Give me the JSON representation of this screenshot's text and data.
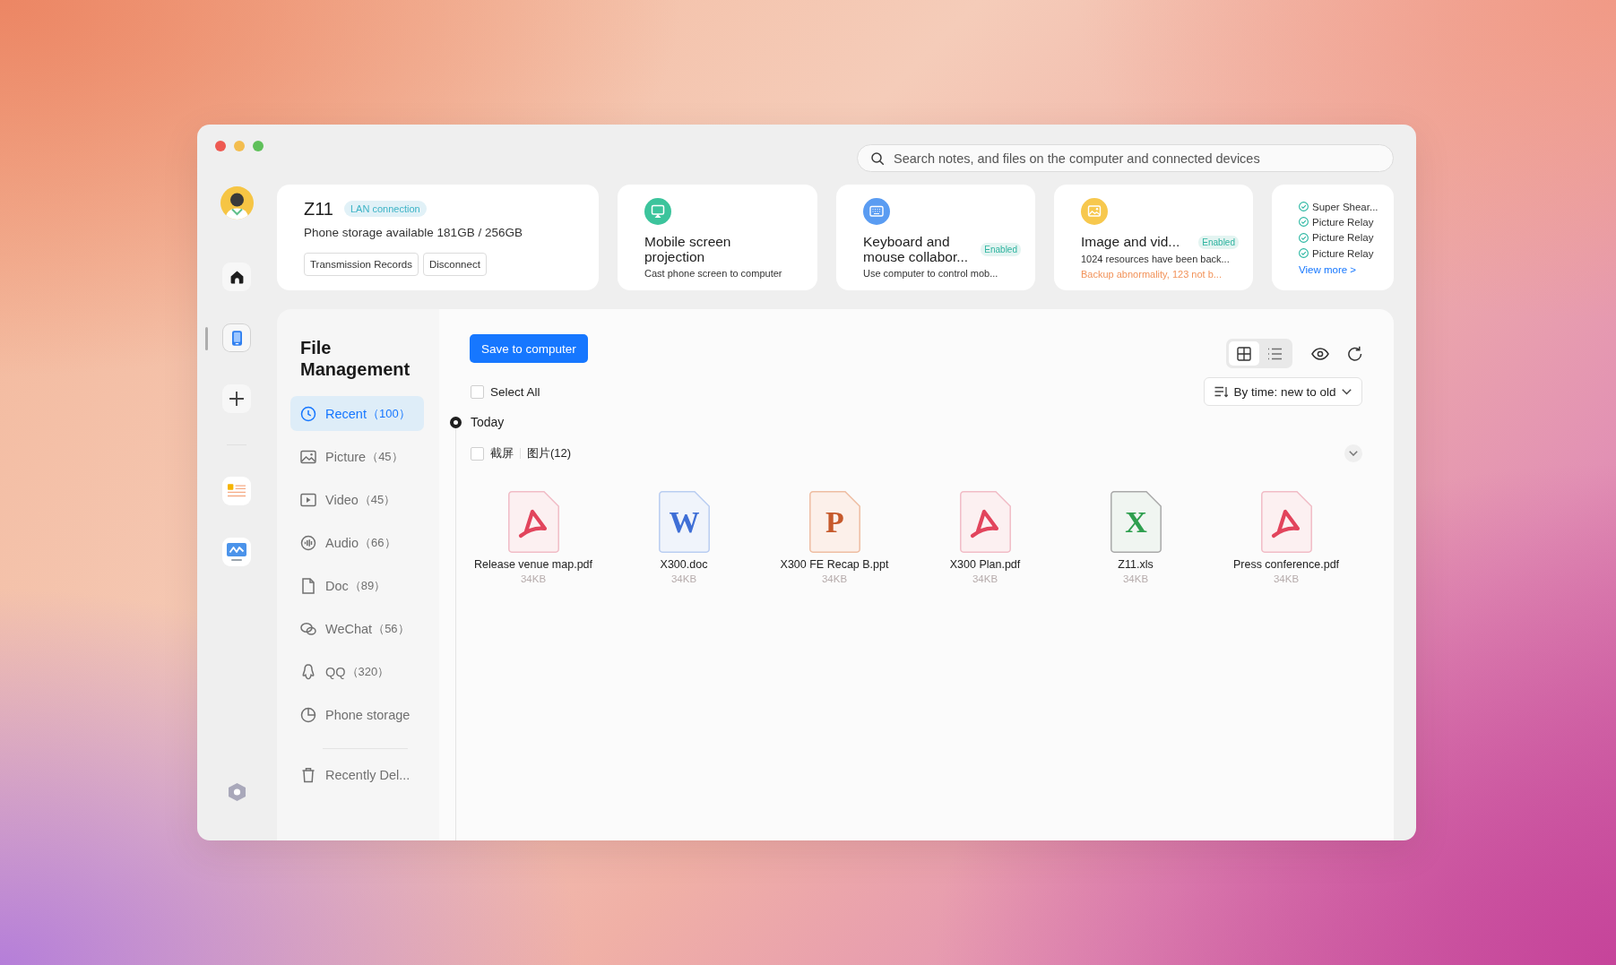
{
  "search": {
    "placeholder": "Search notes, and files on the computer and connected devices"
  },
  "rail": {
    "items": [
      {
        "kind": "home",
        "selected": false
      },
      {
        "kind": "phone",
        "selected": true
      },
      {
        "kind": "add",
        "selected": false
      }
    ],
    "apps": [
      {
        "kind": "notes",
        "selected": false
      },
      {
        "kind": "screen",
        "selected": false
      }
    ]
  },
  "device": {
    "name": "Z11",
    "connection": "LAN connection",
    "storage": "Phone storage available 181GB / 256GB",
    "actions": [
      "Transmission Records",
      "Disconnect"
    ]
  },
  "features": [
    {
      "kind": "projection",
      "title": "Mobile screen projection",
      "description": "Cast phone screen to computer"
    },
    {
      "kind": "keyboard",
      "title": "Keyboard and mouse collabor...",
      "badge": "Enabled",
      "description": "Use computer to control mob..."
    },
    {
      "kind": "gallery",
      "title": "Image and vid...",
      "badge": "Enabled",
      "description": "1024 resources have been back...",
      "warning": "Backup abnormality, 123 not b..."
    }
  ],
  "relay": {
    "items": [
      "Super Shear...",
      "Picture Relay",
      "Picture Relay",
      "Picture Relay"
    ],
    "link": "View more >"
  },
  "file_nav": {
    "title": "File Management",
    "items": [
      {
        "kind": "recent",
        "label": "Recent",
        "count": "（100）",
        "selected": true
      },
      {
        "kind": "picture",
        "label": "Picture",
        "count": "（45）",
        "selected": false
      },
      {
        "kind": "video",
        "label": "Video",
        "count": "（45）",
        "selected": false
      },
      {
        "kind": "audio",
        "label": "Audio",
        "count": "（66）",
        "selected": false
      },
      {
        "kind": "doc",
        "label": "Doc",
        "count": "（89）",
        "selected": false
      },
      {
        "kind": "wechat",
        "label": "WeChat",
        "count": "（56）",
        "selected": false
      },
      {
        "kind": "qq",
        "label": "QQ",
        "count": "（320）",
        "selected": false
      },
      {
        "kind": "storage",
        "label": "Phone storage",
        "selected": false
      }
    ],
    "trash": "Recently Del..."
  },
  "toolbar": {
    "save": "Save to computer",
    "views": [
      {
        "kind": "grid",
        "selected": true
      },
      {
        "kind": "list",
        "selected": false
      }
    ],
    "sort": "By time: new to old"
  },
  "select_all": {
    "label": "Select All",
    "checked": false
  },
  "timeline": [
    {
      "date": "Today",
      "albums": [
        {
          "name": "截屏",
          "category": "图片(12)",
          "checked": false,
          "files": [
            {
              "kind": "pdf",
              "name": "Release venue map.pdf",
              "size": "34KB"
            },
            {
              "kind": "doc",
              "glyph": "W",
              "name": "X300.doc",
              "size": "34KB"
            },
            {
              "kind": "ppt",
              "glyph": "P",
              "name": "X300 FE Recap B.ppt",
              "size": "34KB"
            },
            {
              "kind": "pdf",
              "name": "X300 Plan.pdf",
              "size": "34KB"
            },
            {
              "kind": "xls",
              "glyph": "X",
              "name": "Z11.xls",
              "size": "34KB"
            },
            {
              "kind": "pdf",
              "name": "Press conference.pdf",
              "size": "34KB"
            }
          ]
        }
      ]
    }
  ]
}
